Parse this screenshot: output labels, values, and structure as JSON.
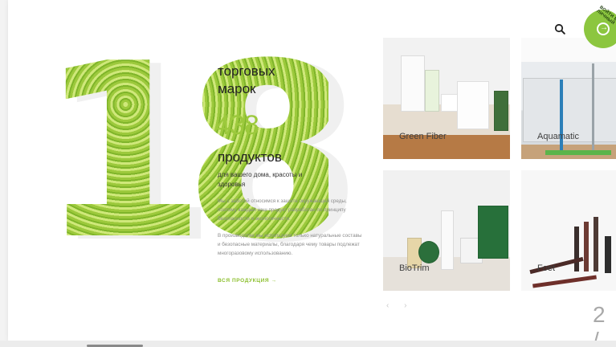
{
  "hero": {
    "big_number": "18",
    "brands_label": "торговых марок",
    "product_count": "438",
    "products_label": "продуктов",
    "subtitle": "для вашего дома, красоты и здоровья",
    "paragraph_1": "Мы с заботой относимся к защите окружающей среды, поэтому каждый наш продукт разработан по принципу безопасности и экологичности.",
    "paragraph_2": "В производстве мы используем только натуральные составы и безопасные материалы, благодаря чему товары подлежат многоразовому использованию.",
    "all_products_link": "ВСЯ ПРОДУКЦИЯ →"
  },
  "brands": [
    {
      "label": "Green Fiber"
    },
    {
      "label": "Aquamatic"
    },
    {
      "label": "BioTrim"
    },
    {
      "label": "Foet"
    }
  ],
  "slider": {
    "prev": "‹",
    "next": "›",
    "page": "2 /"
  },
  "header": {
    "login_badge_text": "ВОЙТИ В ЛИЧНЫЙ",
    "search_icon": "search-icon",
    "login_icon": "login-arrow-icon"
  },
  "colors": {
    "accent": "#8cc63f",
    "link": "#8cbf2e",
    "count": "#9cc93c"
  }
}
